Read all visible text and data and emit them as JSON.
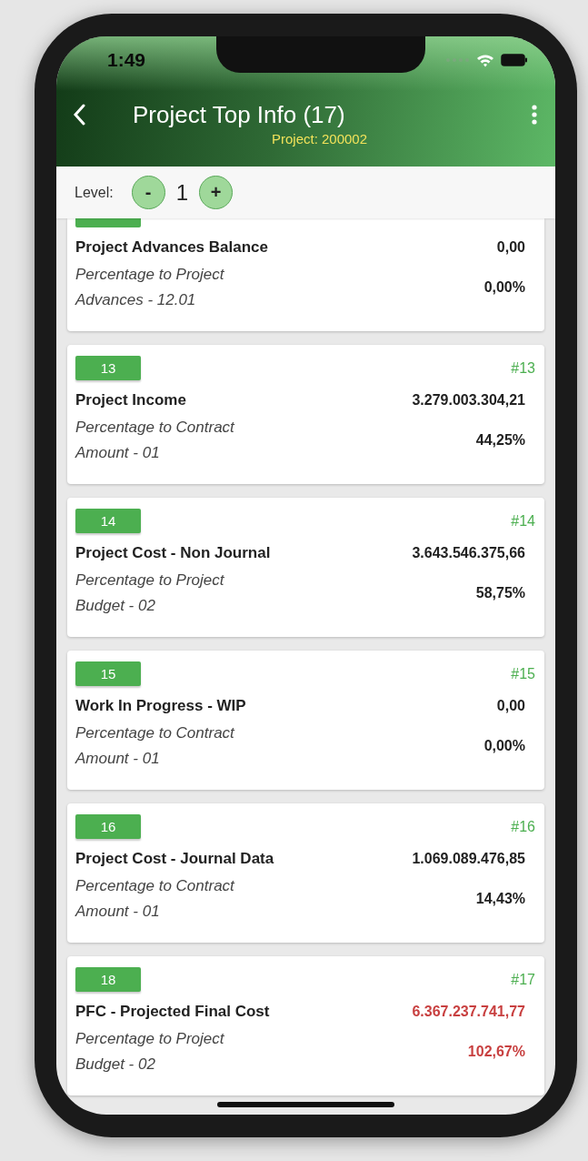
{
  "status_bar": {
    "time": "1:49"
  },
  "header": {
    "title": "Project Top Info (17)",
    "subtitle": "Project: 200002"
  },
  "level_bar": {
    "label": "Level:",
    "value": "1",
    "decrement": "-",
    "increment": "+"
  },
  "cards": [
    {
      "title": "Project Advances Balance",
      "amount": "0,00",
      "description": "Percentage to Project Advances - 12.01",
      "percent": "0,00%",
      "alert": false
    },
    {
      "badge": "13",
      "number": "#13",
      "title": "Project Income",
      "amount": "3.279.003.304,21",
      "description": "Percentage to Contract Amount - 01",
      "percent": "44,25%",
      "alert": false
    },
    {
      "badge": "14",
      "number": "#14",
      "title": "Project Cost - Non Journal",
      "amount": "3.643.546.375,66",
      "description": "Percentage to Project Budget - 02",
      "percent": "58,75%",
      "alert": false
    },
    {
      "badge": "15",
      "number": "#15",
      "title": "Work In Progress - WIP",
      "amount": "0,00",
      "description": "Percentage to Contract Amount - 01",
      "percent": "0,00%",
      "alert": false
    },
    {
      "badge": "16",
      "number": "#16",
      "title": "Project Cost - Journal Data",
      "amount": "1.069.089.476,85",
      "description": "Percentage to Contract Amount - 01",
      "percent": "14,43%",
      "alert": false
    },
    {
      "badge": "18",
      "number": "#17",
      "title": "PFC - Projected Final Cost",
      "amount": "6.367.237.741,77",
      "description": "Percentage to Project Budget - 02",
      "percent": "102,67%",
      "alert": true
    }
  ]
}
